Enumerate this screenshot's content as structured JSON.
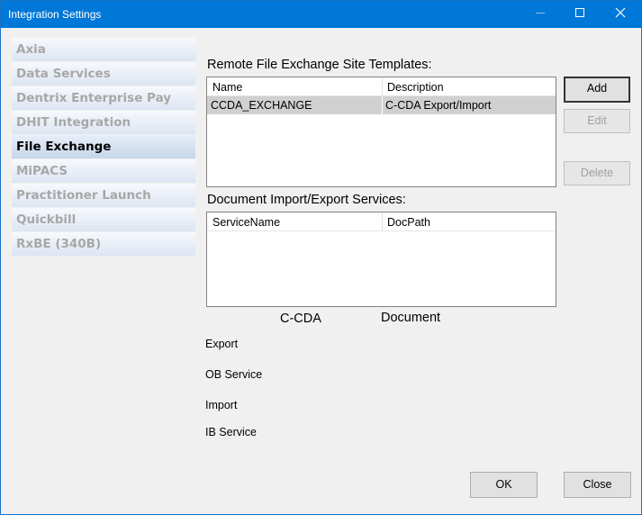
{
  "window": {
    "title": "Integration Settings",
    "minimize_icon": "minimize-icon",
    "maximize_icon": "maximize-icon",
    "close_icon": "close-icon"
  },
  "sidebar": {
    "items": [
      {
        "label": "Axia",
        "selected": false
      },
      {
        "label": "Data Services",
        "selected": false
      },
      {
        "label": "Dentrix Enterprise Pay",
        "selected": false
      },
      {
        "label": "DHIT Integration",
        "selected": false
      },
      {
        "label": "File Exchange",
        "selected": true
      },
      {
        "label": "MiPACS",
        "selected": false
      },
      {
        "label": "Practitioner Launch",
        "selected": false
      },
      {
        "label": "Quickbill",
        "selected": false
      },
      {
        "label": "RxBE (340B)",
        "selected": false
      }
    ]
  },
  "templates": {
    "label": "Remote File Exchange Site Templates:",
    "columns": [
      "Name",
      "Description"
    ],
    "rows": [
      {
        "name": "CCDA_EXCHANGE",
        "description": "C-CDA Export/Import",
        "selected": true
      }
    ],
    "buttons": {
      "add": "Add",
      "edit": "Edit",
      "delete": "Delete"
    }
  },
  "services": {
    "label": "Document Import/Export Services:",
    "columns": [
      "ServiceName",
      "DocPath"
    ],
    "rows": []
  },
  "mapping": {
    "col_ccda": "C-CDA",
    "col_document": "Document",
    "export": "Export",
    "ob_service": "OB Service",
    "import": "Import",
    "ib_service": "IB Service"
  },
  "footer": {
    "ok": "OK",
    "close": "Close"
  }
}
